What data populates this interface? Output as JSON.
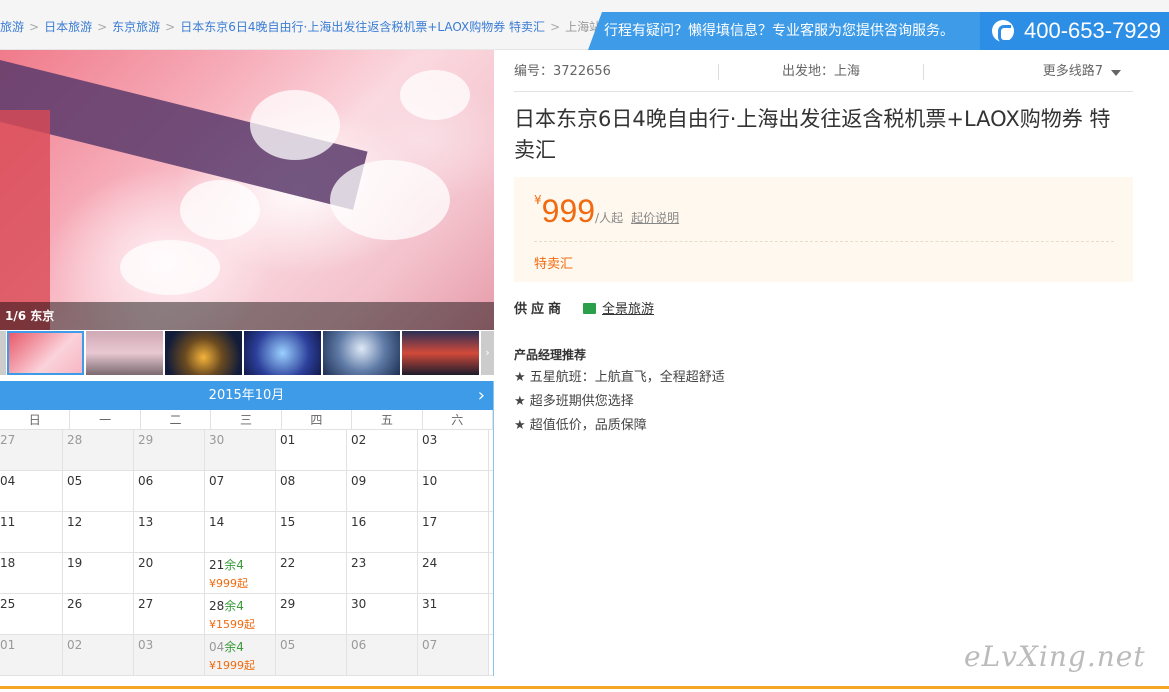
{
  "breadcrumb": {
    "items": [
      "旅游",
      "日本旅游",
      "东京旅游",
      "日本东京6日4晚自由行·上海出发往返含税机票+LAOX购物券 特卖汇"
    ],
    "current": "上海站"
  },
  "help": {
    "text": "行程有疑问？懒得填信息？专业客服为您提供咨询服务。",
    "phone": "400-653-7929"
  },
  "gallery": {
    "caption": "1/6 东京",
    "thumb_count": 6
  },
  "calendar": {
    "month": "2015年10月",
    "weekdays": [
      "日",
      "一",
      "二",
      "三",
      "四",
      "五",
      "六"
    ],
    "rows": [
      [
        {
          "d": "27",
          "off": true
        },
        {
          "d": "28",
          "off": true
        },
        {
          "d": "29",
          "off": true
        },
        {
          "d": "30",
          "off": true
        },
        {
          "d": "01"
        },
        {
          "d": "02"
        },
        {
          "d": "03"
        }
      ],
      [
        {
          "d": "04"
        },
        {
          "d": "05"
        },
        {
          "d": "06"
        },
        {
          "d": "07"
        },
        {
          "d": "08"
        },
        {
          "d": "09"
        },
        {
          "d": "10"
        }
      ],
      [
        {
          "d": "11"
        },
        {
          "d": "12"
        },
        {
          "d": "13"
        },
        {
          "d": "14"
        },
        {
          "d": "15"
        },
        {
          "d": "16"
        },
        {
          "d": "17"
        }
      ],
      [
        {
          "d": "18"
        },
        {
          "d": "19"
        },
        {
          "d": "20"
        },
        {
          "d": "21",
          "rem": "余4",
          "price": "¥999起"
        },
        {
          "d": "22"
        },
        {
          "d": "23"
        },
        {
          "d": "24"
        }
      ],
      [
        {
          "d": "25"
        },
        {
          "d": "26"
        },
        {
          "d": "27"
        },
        {
          "d": "28",
          "rem": "余4",
          "price": "¥1599起"
        },
        {
          "d": "29"
        },
        {
          "d": "30"
        },
        {
          "d": "31"
        }
      ],
      [
        {
          "d": "01",
          "off": true
        },
        {
          "d": "02",
          "off": true
        },
        {
          "d": "03",
          "off": true
        },
        {
          "d": "04",
          "off": true,
          "rem": "余4",
          "price": "¥1999起"
        },
        {
          "d": "05",
          "off": true
        },
        {
          "d": "06",
          "off": true
        },
        {
          "d": "07",
          "off": true
        }
      ]
    ]
  },
  "product": {
    "code": "编号：3722656",
    "departure": "出发地：上海",
    "more_routes": "更多线路7",
    "title": "日本东京6日4晚自由行·上海出发往返含税机票+LAOX购物券 特卖汇",
    "price_symbol": "¥",
    "price": "999",
    "price_unit": "/人起",
    "price_explain": "起价说明",
    "tag": "特卖汇",
    "supplier_label": "供应商",
    "supplier_name": "全景旅游",
    "rec_title": "产品经理推荐",
    "recs": [
      "★ 五星航班：上航直飞，全程超舒适",
      "★ 超多班期供您选择",
      "★ 超值低价，品质保障"
    ]
  },
  "watermark": "eLvXing.net",
  "colors": {
    "accent": "#3d9be8",
    "price": "#f06a10"
  }
}
